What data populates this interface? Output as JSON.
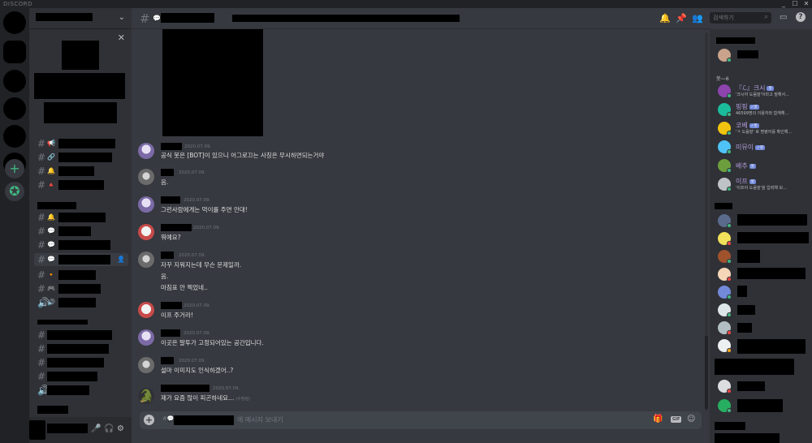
{
  "titlebar": {
    "brand": "DISCORD",
    "min": "_",
    "max": "☐",
    "close": "✕"
  },
  "header": {
    "hash": "#",
    "search_placeholder": "검색하기"
  },
  "messages": [
    {
      "ts": "2020.07.09.",
      "lines": [
        "공식 봇은 [BOT]이 있으니 어그로끄는 사칭은 무시하면되는거야"
      ]
    },
    {
      "ts": "2020.07.09.",
      "lines": [
        "음."
      ]
    },
    {
      "ts": "2020.07.09.",
      "lines": [
        "그런사람에게는 먹이를 주면 안대!"
      ]
    },
    {
      "ts": "2020.07.09.",
      "lines": [
        "뭐예요?"
      ]
    },
    {
      "ts": "2020.07.09.",
      "lines": [
        "자꾸 지워지는데 무슨 문제일까.",
        "음.",
        "마침표 안 찍었네.."
      ]
    },
    {
      "ts": "2020.07.09.",
      "lines": [
        "이프 주거라!"
      ]
    },
    {
      "ts": "2020.07.09.",
      "lines": [
        "이곳은 말투가 고정되어있는 공간입니다."
      ]
    },
    {
      "ts": "2020.07.09.",
      "lines": [
        "설마 이미지도 인식하겠어..?"
      ]
    },
    {
      "ts": "2020.07.09.",
      "lines": [
        "제가 요즘 많이 피곤하네요..."
      ],
      "edited": "(수정됨)"
    }
  ],
  "composer": {
    "placeholder": "에 메시지 보내기",
    "gif": "GIF"
  },
  "members": {
    "role_header": "봇—6",
    "bots": [
      {
        "name": "『ℒ』크시",
        "badge": "봇",
        "status": "'크시야 도움말'이라고 말해서..."
      },
      {
        "name": "핑핑",
        "badge": "✓봇",
        "status": "46599명의 이용자와 함께해..."
      },
      {
        "name": "코베",
        "badge": "✓봇",
        "status": "'ㅋ 도움말' 로 명령어를 확인해..."
      },
      {
        "name": "미뮤이",
        "badge": "✓봇",
        "status": ""
      },
      {
        "name": "배추",
        "badge": "봇",
        "status": ""
      },
      {
        "name": "이프",
        "badge": "봇",
        "status": "'이프야 도움말'을 입력해 보..."
      }
    ]
  }
}
